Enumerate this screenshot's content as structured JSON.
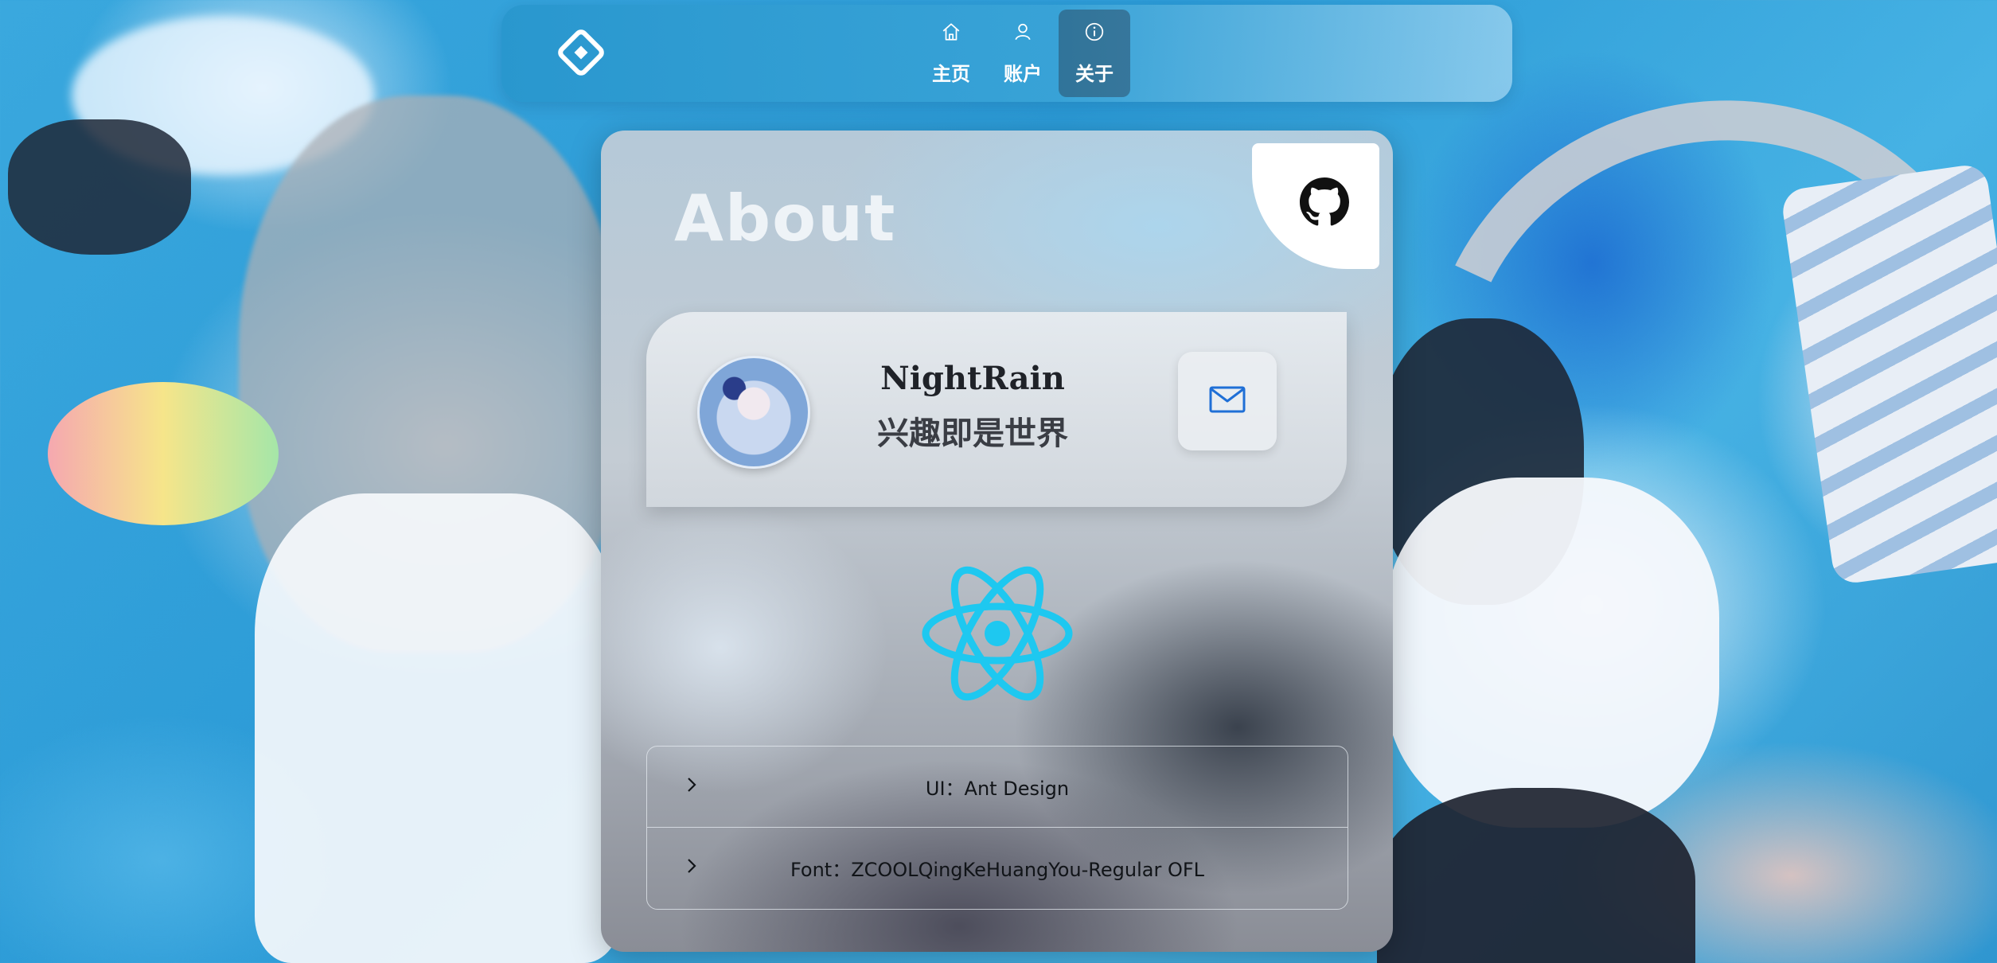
{
  "nav": {
    "items": [
      {
        "label": "主页",
        "icon": "home-icon",
        "active": false
      },
      {
        "label": "账户",
        "icon": "user-icon",
        "active": false
      },
      {
        "label": "关于",
        "icon": "info-icon",
        "active": true
      }
    ]
  },
  "card": {
    "title": "About",
    "profile": {
      "name": "NightRain",
      "motto": "兴趣即是世界"
    },
    "collapse": [
      {
        "label": "UI：Ant Design"
      },
      {
        "label": "Font：ZCOOLQingKeHuangYou-Regular OFL"
      }
    ]
  },
  "colors": {
    "accent": "#1ec8f0",
    "mail_icon": "#1f6fd6",
    "nav_bg": "#2e9bd4"
  }
}
